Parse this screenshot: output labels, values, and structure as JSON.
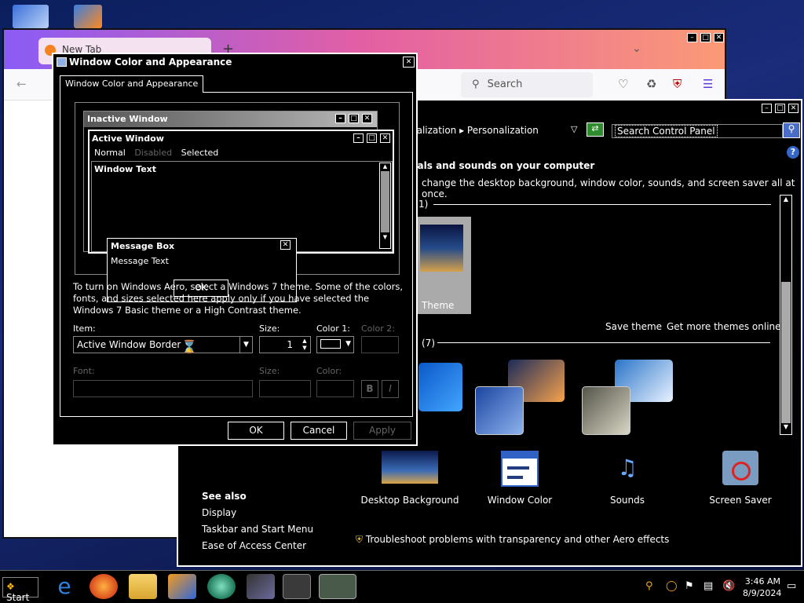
{
  "firefox": {
    "tab_label": "New Tab",
    "new_tab": "+",
    "search_placeholder": "Search"
  },
  "control_panel": {
    "breadcrumb": "nalization ▸ Personalization",
    "search_value": "Search Control Panel",
    "heading": "nals and sounds on your computer",
    "description": "change the desktop background, window color, sounds, and screen saver all at once.",
    "group1_count": "1)",
    "group2_count": "(7)",
    "selected_theme_label": "Theme",
    "save_theme": "Save theme",
    "get_more": "Get more themes online",
    "items": [
      {
        "label": "Desktop Background"
      },
      {
        "label": "Window Color"
      },
      {
        "label": "Sounds"
      },
      {
        "label": "Screen Saver"
      }
    ],
    "see_also": "See also",
    "links": [
      "Display",
      "Taskbar and Start Menu",
      "Ease of Access Center"
    ],
    "troubleshoot": "Troubleshoot problems with transparency and other Aero effects"
  },
  "dialog": {
    "title": "Window Color and Appearance",
    "tab": "Window Color and Appearance",
    "preview": {
      "inactive": "Inactive Window",
      "active": "Active Window",
      "menu": [
        "Normal",
        "Disabled",
        "Selected"
      ],
      "window_text": "Window Text",
      "message_box": "Message Box",
      "message_text": "Message Text",
      "ok": "OK"
    },
    "note": "To turn on Windows Aero, select a Windows 7 theme.  Some of the colors, fonts, and sizes selected here apply only if you have selected the Windows 7 Basic theme or a High Contrast theme.",
    "item_label": "Item:",
    "item_value": "Active Window Border",
    "size_label": "Size:",
    "size_value": "1",
    "color1_label": "Color 1:",
    "color2_label": "Color 2:",
    "font_label": "Font:",
    "fsize_label": "Size:",
    "fcolor_label": "Color:",
    "bold": "B",
    "italic": "I",
    "ok": "OK",
    "cancel": "Cancel",
    "apply": "Apply"
  },
  "taskbar": {
    "start": "Start",
    "time": "3:46 AM",
    "date": "8/9/2024"
  }
}
